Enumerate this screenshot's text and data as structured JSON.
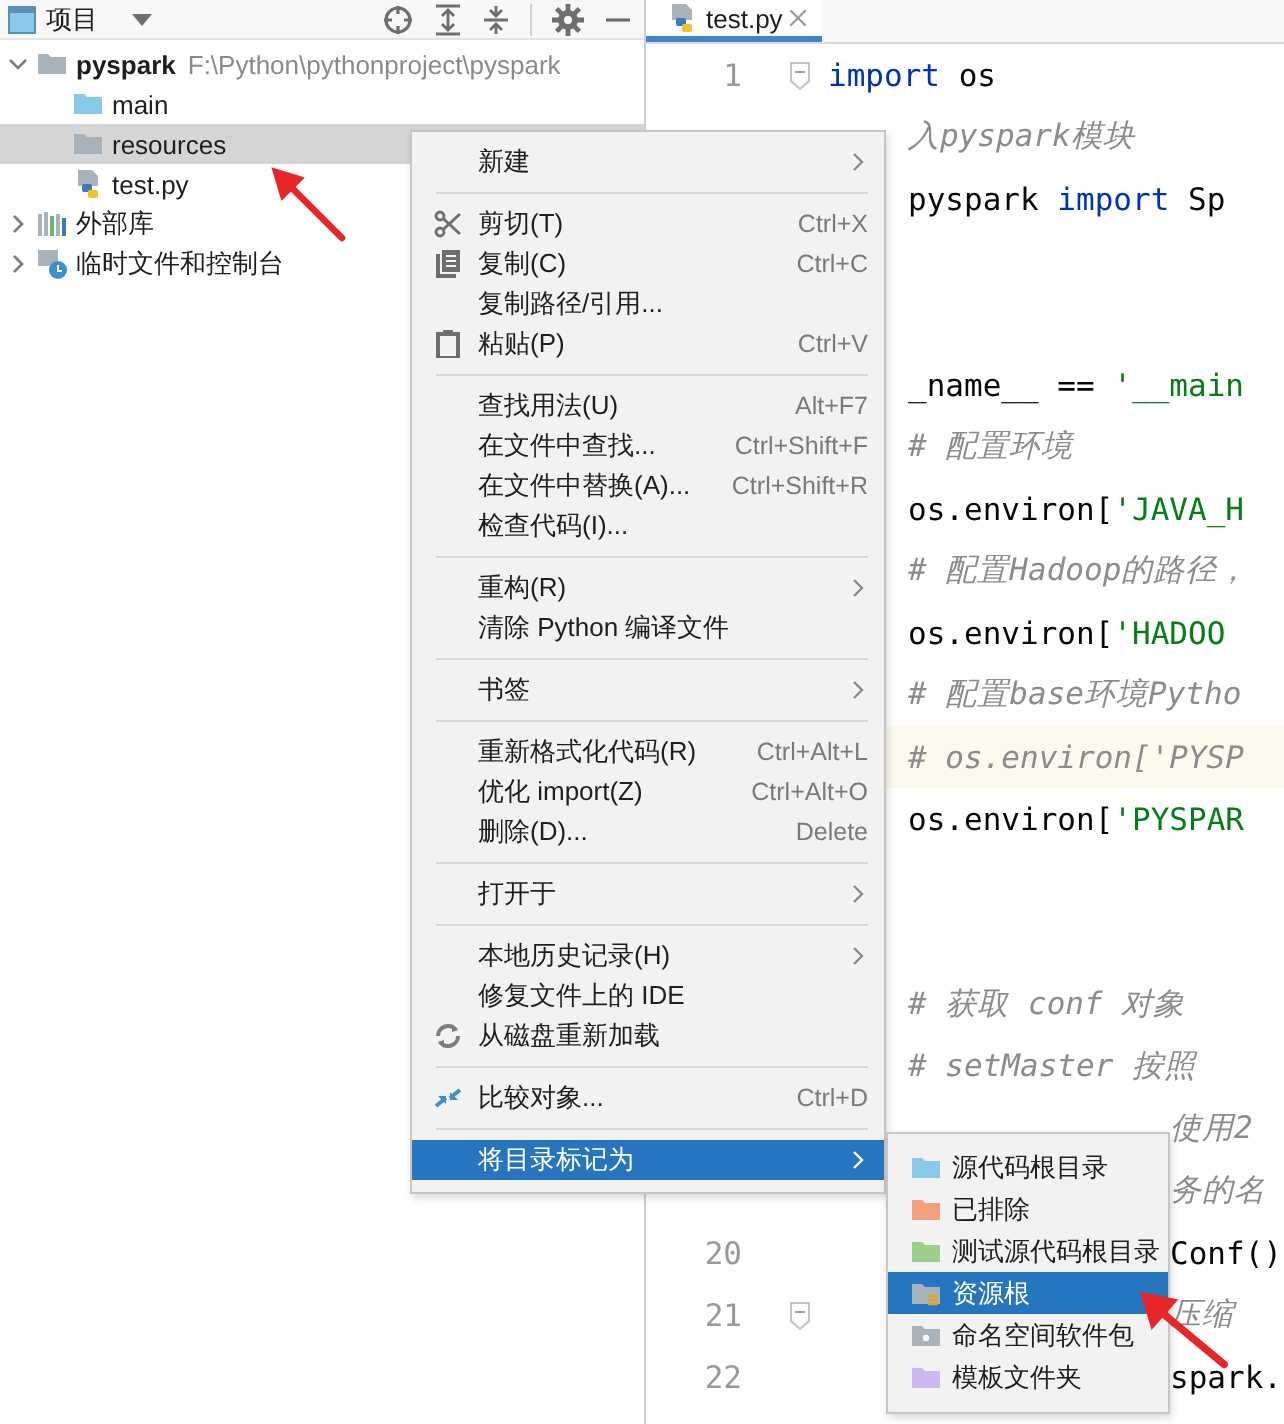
{
  "project_panel": {
    "title": "项目",
    "tree": [
      {
        "label": "pyspark",
        "path": "F:\\Python\\pythonproject\\pyspark",
        "kind": "project",
        "expanded": true,
        "selected": false,
        "children": [
          {
            "label": "main",
            "kind": "source-folder",
            "selected": false
          },
          {
            "label": "resources",
            "kind": "folder",
            "selected": true
          },
          {
            "label": "test.py",
            "kind": "python-file",
            "selected": false
          }
        ]
      },
      {
        "label": "外部库",
        "kind": "library",
        "expanded": false,
        "selected": false
      },
      {
        "label": "临时文件和控制台",
        "kind": "scratches",
        "expanded": false,
        "selected": false
      }
    ]
  },
  "editor": {
    "tabs": [
      {
        "label": "test.py",
        "selected": true
      }
    ],
    "lines": [
      {
        "number": "1",
        "fold": true,
        "current": false,
        "tokens": [
          {
            "kind": "keyword",
            "text": "import"
          },
          {
            "kind": "plain",
            "text": " os"
          }
        ]
      },
      {
        "fold": false,
        "current": false,
        "tokens": [
          {
            "kind": "comment",
            "text": "入pyspark模块"
          }
        ]
      },
      {
        "fold": false,
        "current": false,
        "tokens": [
          {
            "kind": "plain",
            "text": " pyspark "
          },
          {
            "kind": "keyword",
            "text": "import"
          },
          {
            "kind": "plain",
            "text": " Sp"
          }
        ]
      },
      {
        "fold": false,
        "current": false
      },
      {
        "fold": false,
        "current": false
      },
      {
        "fold": false,
        "current": false,
        "tokens": [
          {
            "kind": "plain",
            "text": "_name__ == "
          },
          {
            "kind": "string",
            "text": "'__main"
          }
        ]
      },
      {
        "fold": false,
        "current": false,
        "tokens": [
          {
            "kind": "comment",
            "text": "# 配置环境"
          }
        ]
      },
      {
        "fold": false,
        "current": false,
        "tokens": [
          {
            "kind": "plain",
            "text": "os.environ["
          },
          {
            "kind": "string",
            "text": "'JAVA_H"
          }
        ]
      },
      {
        "fold": false,
        "current": false,
        "tokens": [
          {
            "kind": "comment",
            "text": "# 配置Hadoop的路径，"
          }
        ]
      },
      {
        "fold": false,
        "current": false,
        "tokens": [
          {
            "kind": "plain",
            "text": "os.environ["
          },
          {
            "kind": "string",
            "text": "'HADOO"
          }
        ]
      },
      {
        "fold": false,
        "current": false,
        "tokens": [
          {
            "kind": "comment",
            "text": "# 配置base环境Pytho"
          }
        ]
      },
      {
        "fold": false,
        "current": true,
        "tokens": [
          {
            "kind": "comment",
            "text": "# os.environ['PYSP"
          }
        ]
      },
      {
        "fold": false,
        "current": false,
        "tokens": [
          {
            "kind": "plain",
            "text": "os.environ["
          },
          {
            "kind": "string",
            "text": "'PYSPAR"
          }
        ]
      },
      {
        "fold": false,
        "current": false
      },
      {
        "fold": false,
        "current": false
      },
      {
        "fold": false,
        "current": false,
        "tokens": [
          {
            "kind": "comment",
            "text": "# 获取 conf 对象"
          }
        ]
      },
      {
        "fold": false,
        "current": false,
        "tokens": [
          {
            "kind": "comment",
            "text": "# setMaster  按照"
          }
        ]
      },
      {
        "fold": false,
        "current": false,
        "tokens": [
          {
            "kind": "comment",
            "text": "使用2"
          }
        ]
      },
      {
        "fold": false,
        "current": false,
        "tokens": [
          {
            "kind": "comment",
            "text": "务的名"
          }
        ]
      },
      {
        "number": "20",
        "fold": false,
        "current": false,
        "tokens": [
          {
            "kind": "plain",
            "text": "Conf()"
          }
        ]
      },
      {
        "number": "21",
        "fold": true,
        "current": false,
        "tokens": [
          {
            "kind": "comment",
            "text": "压缩"
          }
        ]
      },
      {
        "number": "22",
        "fold": false,
        "current": false,
        "tokens": [
          {
            "kind": "plain",
            "text": "spark."
          }
        ]
      }
    ]
  },
  "context_menu": {
    "items": [
      {
        "kind": "item",
        "label": "新建",
        "submenu": true,
        "selected": false
      },
      {
        "kind": "separator"
      },
      {
        "kind": "item",
        "label": "剪切(T)",
        "shortcut": "Ctrl+X",
        "submenu": false,
        "selected": false
      },
      {
        "kind": "item",
        "label": "复制(C)",
        "shortcut": "Ctrl+C",
        "submenu": false,
        "selected": false
      },
      {
        "kind": "item",
        "label": "复制路径/引用...",
        "submenu": false,
        "selected": false
      },
      {
        "kind": "item",
        "label": "粘贴(P)",
        "shortcut": "Ctrl+V",
        "submenu": false,
        "selected": false
      },
      {
        "kind": "separator"
      },
      {
        "kind": "item",
        "label": "查找用法(U)",
        "shortcut": "Alt+F7",
        "submenu": false,
        "selected": false
      },
      {
        "kind": "item",
        "label": "在文件中查找...",
        "shortcut": "Ctrl+Shift+F",
        "submenu": false,
        "selected": false
      },
      {
        "kind": "item",
        "label": "在文件中替换(A)...",
        "shortcut": "Ctrl+Shift+R",
        "submenu": false,
        "selected": false
      },
      {
        "kind": "item",
        "label": "检查代码(I)...",
        "submenu": false,
        "selected": false
      },
      {
        "kind": "separator"
      },
      {
        "kind": "item",
        "label": "重构(R)",
        "submenu": true,
        "selected": false
      },
      {
        "kind": "item",
        "label": "清除 Python 编译文件",
        "submenu": false,
        "selected": false
      },
      {
        "kind": "separator"
      },
      {
        "kind": "item",
        "label": "书签",
        "submenu": true,
        "selected": false
      },
      {
        "kind": "separator"
      },
      {
        "kind": "item",
        "label": "重新格式化代码(R)",
        "shortcut": "Ctrl+Alt+L",
        "submenu": false,
        "selected": false
      },
      {
        "kind": "item",
        "label": "优化 import(Z)",
        "shortcut": "Ctrl+Alt+O",
        "submenu": false,
        "selected": false
      },
      {
        "kind": "item",
        "label": "删除(D)...",
        "shortcut": "Delete",
        "submenu": false,
        "selected": false
      },
      {
        "kind": "separator"
      },
      {
        "kind": "item",
        "label": "打开于",
        "submenu": true,
        "selected": false
      },
      {
        "kind": "separator"
      },
      {
        "kind": "item",
        "label": "本地历史记录(H)",
        "submenu": true,
        "selected": false
      },
      {
        "kind": "item",
        "label": "修复文件上的 IDE",
        "submenu": false,
        "selected": false
      },
      {
        "kind": "item",
        "label": "从磁盘重新加载",
        "submenu": false,
        "selected": false
      },
      {
        "kind": "separator"
      },
      {
        "kind": "item",
        "label": "比较对象...",
        "shortcut": "Ctrl+D",
        "submenu": false,
        "selected": false
      },
      {
        "kind": "separator"
      },
      {
        "kind": "item",
        "label": "将目录标记为",
        "submenu": true,
        "selected": true
      }
    ]
  },
  "submenu": {
    "items": [
      {
        "label": "源代码根目录",
        "kind": "folder",
        "color": "#87c9e6",
        "selected": false
      },
      {
        "label": "已排除",
        "kind": "folder",
        "color": "#f0a07c",
        "selected": false
      },
      {
        "label": "测试源代码根目录",
        "kind": "folder",
        "color": "#9ccf8a",
        "selected": false
      },
      {
        "label": "资源根",
        "kind": "resource",
        "color": "#a8b2ba",
        "selected": true
      },
      {
        "label": "命名空间软件包",
        "kind": "namespace",
        "color": "#a8b2ba",
        "selected": false
      },
      {
        "label": "模板文件夹",
        "kind": "folder",
        "color": "#cdb8f0",
        "selected": false
      }
    ]
  }
}
